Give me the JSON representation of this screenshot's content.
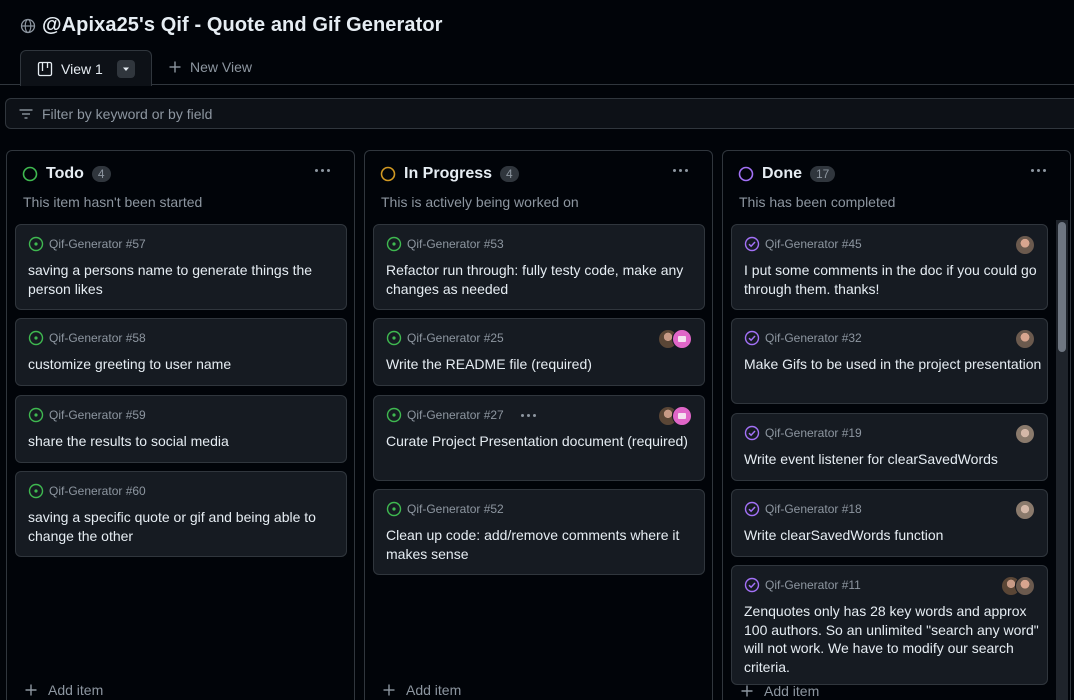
{
  "project": {
    "title": "@Apixa25's Qif - Quote and Gif Generator"
  },
  "views": {
    "active": {
      "label": "View 1"
    },
    "new_view_label": "New View"
  },
  "filter": {
    "placeholder": "Filter by keyword or by field"
  },
  "columns": [
    {
      "name": "Todo",
      "count": "4",
      "description": "This item hasn't been started",
      "status_color": "#3fb950",
      "add_item_label": "Add item",
      "cards": [
        {
          "ref": "Qif-Generator #57",
          "title": "saving a persons name to generate things the person likes",
          "state_icon": "open-issue-icon"
        },
        {
          "ref": "Qif-Generator #58",
          "title": "customize greeting to user name",
          "state_icon": "open-issue-icon"
        },
        {
          "ref": "Qif-Generator #59",
          "title": "share the results to social media",
          "state_icon": "open-issue-icon"
        },
        {
          "ref": "Qif-Generator #60",
          "title": "saving a specific quote or gif and being able to change the other",
          "state_icon": "open-issue-icon"
        }
      ]
    },
    {
      "name": "In Progress",
      "count": "4",
      "description": "This is actively being worked on",
      "status_color": "#d29922",
      "add_item_label": "Add item",
      "cards": [
        {
          "ref": "Qif-Generator #53",
          "title": "Refactor run through: fully testy code, make any changes as needed",
          "state_icon": "open-issue-icon"
        },
        {
          "ref": "Qif-Generator #25",
          "title": "Write the README file (required)",
          "state_icon": "open-issue-icon"
        },
        {
          "ref": "Qif-Generator #27",
          "title": "Curate Project Presentation document (required)",
          "state_icon": "open-issue-icon"
        },
        {
          "ref": "Qif-Generator #52",
          "title": "Clean up code: add/remove comments where it makes sense",
          "state_icon": "open-issue-icon"
        }
      ]
    },
    {
      "name": "Done",
      "count": "17",
      "description": "This has been completed",
      "status_color": "#a371f7",
      "add_item_label": "Add item",
      "cards": [
        {
          "ref": "Qif-Generator #45",
          "title": "I put some comments in the doc if you could go through them. thanks!",
          "state_icon": "closed-issue-icon"
        },
        {
          "ref": "Qif-Generator #32",
          "title": "Make Gifs to be used in the project presentation",
          "state_icon": "closed-issue-icon"
        },
        {
          "ref": "Qif-Generator #19",
          "title": "Write event listener for clearSavedWords",
          "state_icon": "closed-issue-icon"
        },
        {
          "ref": "Qif-Generator #18",
          "title": "Write clearSavedWords function",
          "state_icon": "closed-issue-icon"
        },
        {
          "ref": "Qif-Generator #11",
          "title": "Zenquotes only has 28 key words and approx 100 authors. So an unlimited \"search any word\" will not work. We have to modify our search criteria.",
          "state_icon": "closed-issue-icon"
        }
      ]
    }
  ],
  "colors": {
    "open": "#3fb950",
    "in_progress": "#d29922",
    "done": "#a371f7",
    "accent_pink": "#db61a2"
  }
}
